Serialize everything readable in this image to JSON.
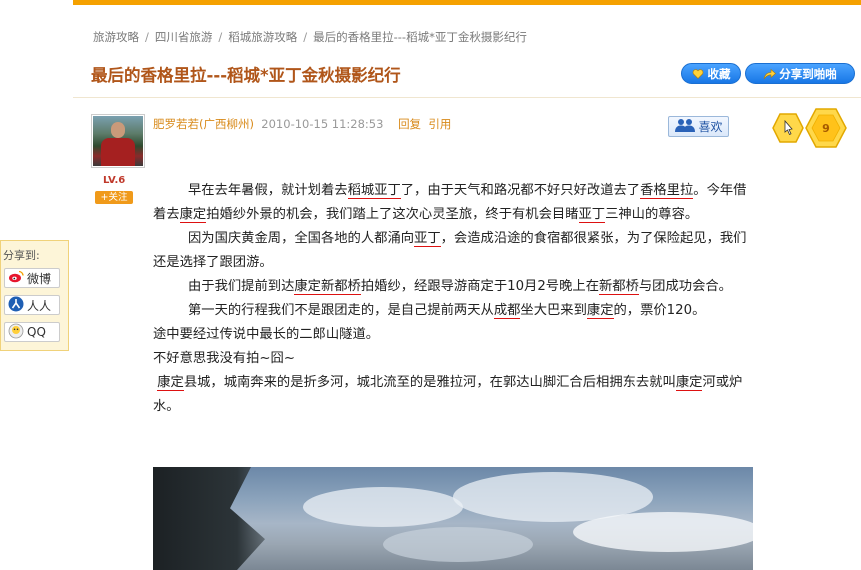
{
  "breadcrumb": {
    "items": [
      "旅游攻略",
      "四川省旅游",
      "稻城旅游攻略",
      "最后的香格里拉---稻城*亚丁金秋摄影纪行"
    ],
    "separator": "/"
  },
  "page_title": "最后的香格里拉---稻城*亚丁金秋摄影纪行",
  "actions": {
    "favorite_label": "收藏",
    "share_label": "分享到啪啪"
  },
  "post": {
    "author": "肥罗若若(广西柳州)",
    "datetime": "2010-10-15 11:28:53",
    "reply_label": "回复",
    "quote_label": "引用",
    "level": "LV.6",
    "follow_label": "关注",
    "like_label": "喜欢",
    "honey_count": "9"
  },
  "sidebar_share": {
    "title": "分享到:",
    "weibo": "微博",
    "renren": "人人",
    "qq": "QQ"
  },
  "paragraphs": {
    "p1": [
      "早在去年暑假，就计划着去",
      "稻城亚丁",
      "了，由于天气和路况都不好只好改道去了",
      "香格里拉",
      "。今年借着去",
      "康定",
      "拍婚纱外景的机会，我们踏上了这次心灵圣旅，终于有机会目睹",
      "亚丁",
      "三神山的尊容。"
    ],
    "p2": [
      "因为国庆黄金周，全国各地的人都涌向",
      "亚丁",
      "，会造成沿途的食宿都很紧张，为了保险起见，我们还是选择了跟团游。"
    ],
    "p3": [
      "由于我们提前到达",
      "康定新都桥",
      "拍婚纱，经跟导游商定于10月2号晚上在",
      "新都桥",
      "与团成功会合。"
    ],
    "p4": [
      "第一天的行程我们不是跟团走的，是自己提前两天从",
      "成都",
      "坐大巴来到",
      "康定",
      "的，票价120。"
    ],
    "p5": "途中要经过传说中最长的二郎山隧道。",
    "p6": "不好意思我没有拍~囧~",
    "p7": [
      "康定",
      "县城，城南奔来的是折多河，城北流至的是雅拉河，在郭达山脚汇合后相拥东去就叫",
      "康定",
      "河或炉水。"
    ]
  },
  "colors": {
    "accent": "#f5a100",
    "title": "#b0561a",
    "link": "#d88a1a",
    "button": "#1877e6"
  }
}
